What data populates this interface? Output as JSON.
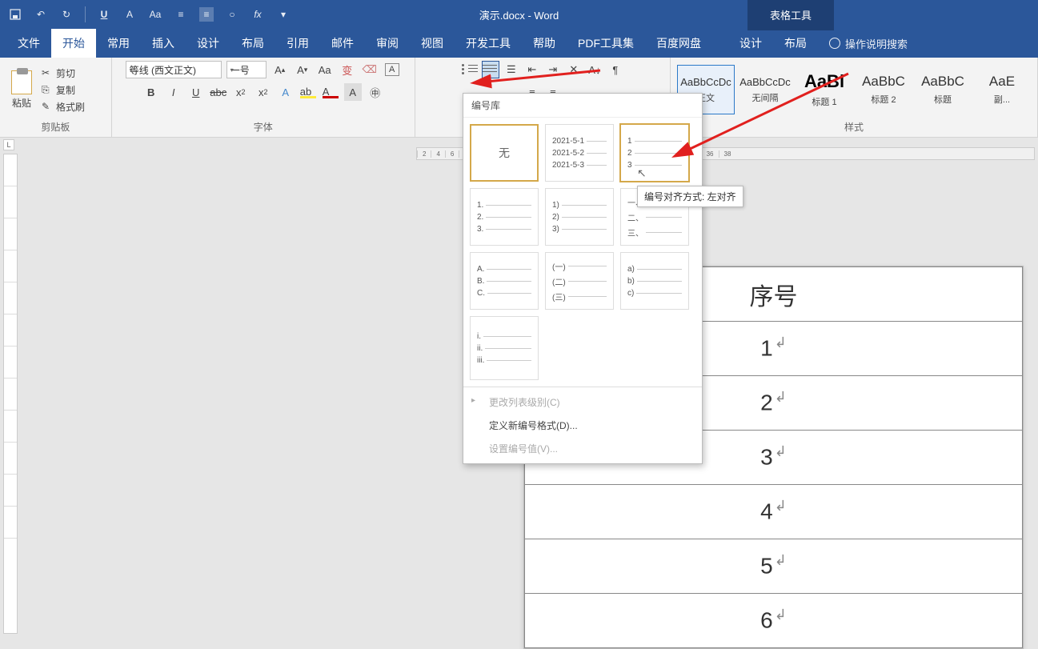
{
  "title": "演示.docx - Word",
  "table_tools": "表格工具",
  "tabs": [
    "文件",
    "开始",
    "常用",
    "插入",
    "设计",
    "布局",
    "引用",
    "邮件",
    "审阅",
    "视图",
    "开发工具",
    "帮助",
    "PDF工具集",
    "百度网盘"
  ],
  "context_tabs": [
    "设计",
    "布局"
  ],
  "tell_me": "操作说明搜索",
  "clipboard": {
    "paste": "粘贴",
    "cut": "剪切",
    "copy": "复制",
    "format": "格式刷",
    "label": "剪贴板"
  },
  "font": {
    "name": "等线 (西文正文)",
    "size": "一号",
    "label": "字体"
  },
  "styles": {
    "label": "样式",
    "items": [
      {
        "preview": "AaBbCcDc",
        "name": "正文",
        "cls": ""
      },
      {
        "preview": "AaBbCcDc",
        "name": "无间隔",
        "cls": ""
      },
      {
        "preview": "AaBl",
        "name": "标题 1",
        "cls": "big"
      },
      {
        "preview": "AaBbC",
        "name": "标题 2",
        "cls": "med"
      },
      {
        "preview": "AaBbC",
        "name": "标题",
        "cls": "med"
      },
      {
        "preview": "AaE",
        "name": "副...",
        "cls": "med"
      }
    ]
  },
  "numbering": {
    "header": "编号库",
    "none": "无",
    "options": [
      {
        "lines": [
          "2021-5-1",
          "2021-5-2",
          "2021-5-3"
        ]
      },
      {
        "lines": [
          "1",
          "2",
          "3"
        ],
        "hover": true
      },
      {
        "lines": [
          "1.",
          "2.",
          "3."
        ]
      },
      {
        "lines": [
          "1)",
          "2)",
          "3)"
        ]
      },
      {
        "lines": [
          "一、",
          "二、",
          "三、"
        ]
      },
      {
        "lines": [
          "A.",
          "B.",
          "C."
        ]
      },
      {
        "lines": [
          "(一)",
          "(二)",
          "(三)"
        ]
      },
      {
        "lines": [
          "a)",
          "b)",
          "c)"
        ]
      },
      {
        "lines": [
          "i.",
          "ii.",
          "iii."
        ],
        "roman": true
      }
    ],
    "menu": [
      {
        "label": "更改列表级别(C)",
        "disabled": true,
        "chev": true
      },
      {
        "label": "定义新编号格式(D)...",
        "disabled": false
      },
      {
        "label": "设置编号值(V)...",
        "disabled": true
      }
    ]
  },
  "tooltip": "编号对齐方式: 左对齐",
  "table": {
    "header": "序号",
    "rows": [
      "1",
      "2",
      "3",
      "4",
      "5",
      "6"
    ]
  },
  "ruler_corner": "L"
}
